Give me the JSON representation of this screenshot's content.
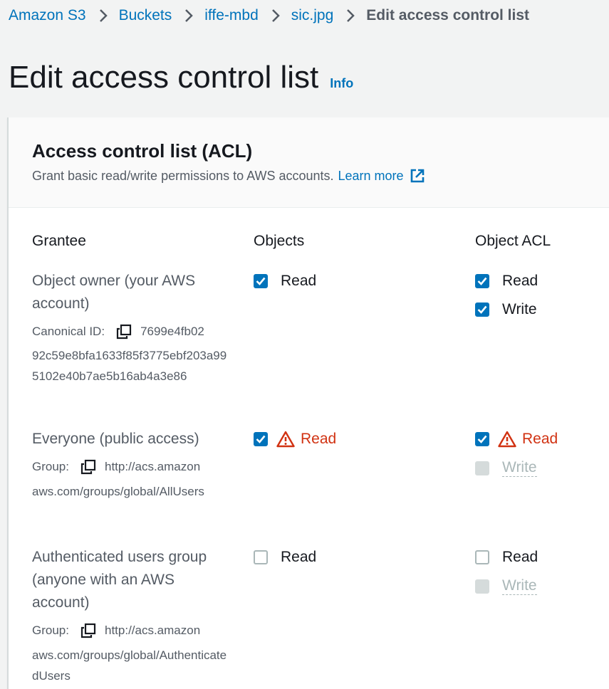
{
  "breadcrumb": {
    "items": [
      "Amazon S3",
      "Buckets",
      "iffe-mbd",
      "sic.jpg"
    ],
    "current": "Edit access control list"
  },
  "page": {
    "title": "Edit access control list",
    "info": "Info"
  },
  "panel": {
    "title": "Access control list (ACL)",
    "description": "Grant basic read/write permissions to AWS accounts.",
    "learn_more": "Learn more"
  },
  "columns": {
    "grantee": "Grantee",
    "objects": "Objects",
    "object_acl": "Object ACL"
  },
  "grantees": [
    {
      "name": "Object owner (your AWS account)",
      "id_label": "Canonical ID:",
      "id_first": "7699e4fb02",
      "id_rest": "92c59e8bfa1633f85f3775ebf203a995102e40b7ae5b16ab4a3e86",
      "objects_read": {
        "label": "Read",
        "checked": true
      },
      "acl_read": {
        "label": "Read",
        "checked": true
      },
      "acl_write": {
        "label": "Write",
        "checked": true
      }
    },
    {
      "name": "Everyone (public access)",
      "id_label": "Group:",
      "id_first": "http://acs.amazon",
      "id_rest": "aws.com/groups/global/AllUsers",
      "objects_read": {
        "label": "Read",
        "checked": true,
        "warning": true
      },
      "acl_read": {
        "label": "Read",
        "checked": true,
        "warning": true
      },
      "acl_write": {
        "label": "Write",
        "checked": false,
        "disabled": true
      }
    },
    {
      "name": "Authenticated users group (anyone with an AWS account)",
      "id_label": "Group:",
      "id_first": "http://acs.amazon",
      "id_rest": "aws.com/groups/global/AuthenticatedUsers",
      "objects_read": {
        "label": "Read",
        "checked": false
      },
      "acl_read": {
        "label": "Read",
        "checked": false
      },
      "acl_write": {
        "label": "Write",
        "checked": false,
        "disabled": true
      }
    }
  ],
  "colors": {
    "link": "#0073bb",
    "text": "#16191f",
    "secondary": "#545b64",
    "warning": "#d13212",
    "disabled": "#aab7b8",
    "page_bg": "#f2f3f3"
  }
}
